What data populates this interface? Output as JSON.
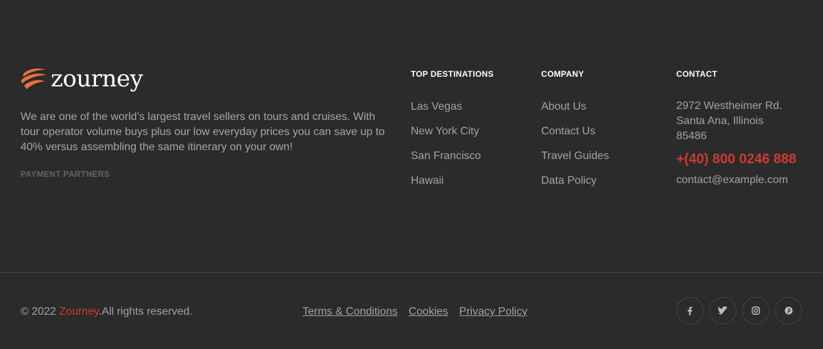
{
  "brand": {
    "name": "zourney",
    "logo_icon": "globe-swoosh-icon",
    "accent_color": "#e8733a"
  },
  "about": {
    "text": "We are one of the world’s largest travel sellers on tours and cruises. With tour operator volume buys plus our low everyday prices you can save up to 40% versus assembling the same itinerary on your own!",
    "payment_title": "PAYMENT PARTNERS"
  },
  "columns": {
    "destinations": {
      "title": "TOP DESTINATIONS",
      "items": [
        "Las Vegas",
        "New York City",
        "San Francisco",
        "Hawaii"
      ]
    },
    "company": {
      "title": "COMPANY",
      "items": [
        "About Us",
        "Contact Us",
        "Travel Guides",
        "Data Policy"
      ]
    },
    "contact": {
      "title": "CONTACT",
      "address": "2972 Westheimer Rd. Santa Ana, Illinois 85486",
      "phone": "+(40) 800 0246 888",
      "email": "contact@example.com"
    }
  },
  "bottom": {
    "copyright_prefix": "© 2022 ",
    "copyright_brand": "Zourney",
    "copyright_suffix": ".All rights reserved.",
    "links": [
      "Terms & Conditions",
      "Cookies",
      "Privacy Policy"
    ],
    "social": [
      {
        "icon": "facebook-icon",
        "glyph": "f"
      },
      {
        "icon": "twitter-icon",
        "glyph": "t"
      },
      {
        "icon": "instagram-icon",
        "glyph": "ig"
      },
      {
        "icon": "pinterest-icon",
        "glyph": "p"
      }
    ]
  },
  "colors": {
    "background": "#2b2b2b",
    "accent_red": "#cc3b32",
    "heading": "#ffffff",
    "text": "#a3a3a3"
  }
}
